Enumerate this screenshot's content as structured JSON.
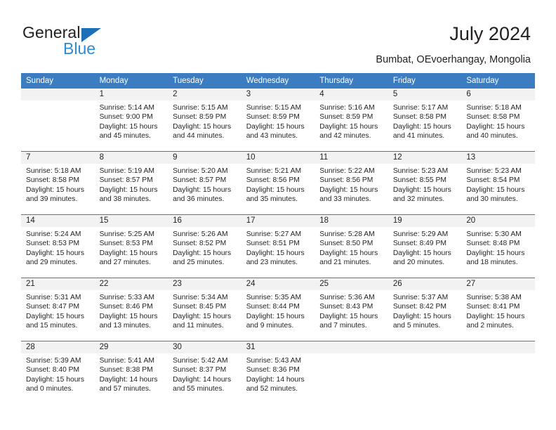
{
  "brand": {
    "name_part1": "General",
    "name_part2": "Blue",
    "accent_color": "#2e8bd4",
    "triangle_color": "#1d70b8"
  },
  "header": {
    "title": "July 2024",
    "location": "Bumbat, OEvoerhangay, Mongolia"
  },
  "calendar": {
    "header_bg": "#3b7dc0",
    "daynum_bg": "#f2f2f2",
    "weekday_names": [
      "Sunday",
      "Monday",
      "Tuesday",
      "Wednesday",
      "Thursday",
      "Friday",
      "Saturday"
    ],
    "weeks": [
      [
        {
          "day": "",
          "sunrise": "",
          "sunset": "",
          "daylight1": "",
          "daylight2": ""
        },
        {
          "day": "1",
          "sunrise": "Sunrise: 5:14 AM",
          "sunset": "Sunset: 9:00 PM",
          "daylight1": "Daylight: 15 hours",
          "daylight2": "and 45 minutes."
        },
        {
          "day": "2",
          "sunrise": "Sunrise: 5:15 AM",
          "sunset": "Sunset: 8:59 PM",
          "daylight1": "Daylight: 15 hours",
          "daylight2": "and 44 minutes."
        },
        {
          "day": "3",
          "sunrise": "Sunrise: 5:15 AM",
          "sunset": "Sunset: 8:59 PM",
          "daylight1": "Daylight: 15 hours",
          "daylight2": "and 43 minutes."
        },
        {
          "day": "4",
          "sunrise": "Sunrise: 5:16 AM",
          "sunset": "Sunset: 8:59 PM",
          "daylight1": "Daylight: 15 hours",
          "daylight2": "and 42 minutes."
        },
        {
          "day": "5",
          "sunrise": "Sunrise: 5:17 AM",
          "sunset": "Sunset: 8:58 PM",
          "daylight1": "Daylight: 15 hours",
          "daylight2": "and 41 minutes."
        },
        {
          "day": "6",
          "sunrise": "Sunrise: 5:18 AM",
          "sunset": "Sunset: 8:58 PM",
          "daylight1": "Daylight: 15 hours",
          "daylight2": "and 40 minutes."
        }
      ],
      [
        {
          "day": "7",
          "sunrise": "Sunrise: 5:18 AM",
          "sunset": "Sunset: 8:58 PM",
          "daylight1": "Daylight: 15 hours",
          "daylight2": "and 39 minutes."
        },
        {
          "day": "8",
          "sunrise": "Sunrise: 5:19 AM",
          "sunset": "Sunset: 8:57 PM",
          "daylight1": "Daylight: 15 hours",
          "daylight2": "and 38 minutes."
        },
        {
          "day": "9",
          "sunrise": "Sunrise: 5:20 AM",
          "sunset": "Sunset: 8:57 PM",
          "daylight1": "Daylight: 15 hours",
          "daylight2": "and 36 minutes."
        },
        {
          "day": "10",
          "sunrise": "Sunrise: 5:21 AM",
          "sunset": "Sunset: 8:56 PM",
          "daylight1": "Daylight: 15 hours",
          "daylight2": "and 35 minutes."
        },
        {
          "day": "11",
          "sunrise": "Sunrise: 5:22 AM",
          "sunset": "Sunset: 8:56 PM",
          "daylight1": "Daylight: 15 hours",
          "daylight2": "and 33 minutes."
        },
        {
          "day": "12",
          "sunrise": "Sunrise: 5:23 AM",
          "sunset": "Sunset: 8:55 PM",
          "daylight1": "Daylight: 15 hours",
          "daylight2": "and 32 minutes."
        },
        {
          "day": "13",
          "sunrise": "Sunrise: 5:23 AM",
          "sunset": "Sunset: 8:54 PM",
          "daylight1": "Daylight: 15 hours",
          "daylight2": "and 30 minutes."
        }
      ],
      [
        {
          "day": "14",
          "sunrise": "Sunrise: 5:24 AM",
          "sunset": "Sunset: 8:53 PM",
          "daylight1": "Daylight: 15 hours",
          "daylight2": "and 29 minutes."
        },
        {
          "day": "15",
          "sunrise": "Sunrise: 5:25 AM",
          "sunset": "Sunset: 8:53 PM",
          "daylight1": "Daylight: 15 hours",
          "daylight2": "and 27 minutes."
        },
        {
          "day": "16",
          "sunrise": "Sunrise: 5:26 AM",
          "sunset": "Sunset: 8:52 PM",
          "daylight1": "Daylight: 15 hours",
          "daylight2": "and 25 minutes."
        },
        {
          "day": "17",
          "sunrise": "Sunrise: 5:27 AM",
          "sunset": "Sunset: 8:51 PM",
          "daylight1": "Daylight: 15 hours",
          "daylight2": "and 23 minutes."
        },
        {
          "day": "18",
          "sunrise": "Sunrise: 5:28 AM",
          "sunset": "Sunset: 8:50 PM",
          "daylight1": "Daylight: 15 hours",
          "daylight2": "and 21 minutes."
        },
        {
          "day": "19",
          "sunrise": "Sunrise: 5:29 AM",
          "sunset": "Sunset: 8:49 PM",
          "daylight1": "Daylight: 15 hours",
          "daylight2": "and 20 minutes."
        },
        {
          "day": "20",
          "sunrise": "Sunrise: 5:30 AM",
          "sunset": "Sunset: 8:48 PM",
          "daylight1": "Daylight: 15 hours",
          "daylight2": "and 18 minutes."
        }
      ],
      [
        {
          "day": "21",
          "sunrise": "Sunrise: 5:31 AM",
          "sunset": "Sunset: 8:47 PM",
          "daylight1": "Daylight: 15 hours",
          "daylight2": "and 15 minutes."
        },
        {
          "day": "22",
          "sunrise": "Sunrise: 5:33 AM",
          "sunset": "Sunset: 8:46 PM",
          "daylight1": "Daylight: 15 hours",
          "daylight2": "and 13 minutes."
        },
        {
          "day": "23",
          "sunrise": "Sunrise: 5:34 AM",
          "sunset": "Sunset: 8:45 PM",
          "daylight1": "Daylight: 15 hours",
          "daylight2": "and 11 minutes."
        },
        {
          "day": "24",
          "sunrise": "Sunrise: 5:35 AM",
          "sunset": "Sunset: 8:44 PM",
          "daylight1": "Daylight: 15 hours",
          "daylight2": "and 9 minutes."
        },
        {
          "day": "25",
          "sunrise": "Sunrise: 5:36 AM",
          "sunset": "Sunset: 8:43 PM",
          "daylight1": "Daylight: 15 hours",
          "daylight2": "and 7 minutes."
        },
        {
          "day": "26",
          "sunrise": "Sunrise: 5:37 AM",
          "sunset": "Sunset: 8:42 PM",
          "daylight1": "Daylight: 15 hours",
          "daylight2": "and 5 minutes."
        },
        {
          "day": "27",
          "sunrise": "Sunrise: 5:38 AM",
          "sunset": "Sunset: 8:41 PM",
          "daylight1": "Daylight: 15 hours",
          "daylight2": "and 2 minutes."
        }
      ],
      [
        {
          "day": "28",
          "sunrise": "Sunrise: 5:39 AM",
          "sunset": "Sunset: 8:40 PM",
          "daylight1": "Daylight: 15 hours",
          "daylight2": "and 0 minutes."
        },
        {
          "day": "29",
          "sunrise": "Sunrise: 5:41 AM",
          "sunset": "Sunset: 8:38 PM",
          "daylight1": "Daylight: 14 hours",
          "daylight2": "and 57 minutes."
        },
        {
          "day": "30",
          "sunrise": "Sunrise: 5:42 AM",
          "sunset": "Sunset: 8:37 PM",
          "daylight1": "Daylight: 14 hours",
          "daylight2": "and 55 minutes."
        },
        {
          "day": "31",
          "sunrise": "Sunrise: 5:43 AM",
          "sunset": "Sunset: 8:36 PM",
          "daylight1": "Daylight: 14 hours",
          "daylight2": "and 52 minutes."
        },
        {
          "day": "",
          "sunrise": "",
          "sunset": "",
          "daylight1": "",
          "daylight2": ""
        },
        {
          "day": "",
          "sunrise": "",
          "sunset": "",
          "daylight1": "",
          "daylight2": ""
        },
        {
          "day": "",
          "sunrise": "",
          "sunset": "",
          "daylight1": "",
          "daylight2": ""
        }
      ]
    ]
  }
}
